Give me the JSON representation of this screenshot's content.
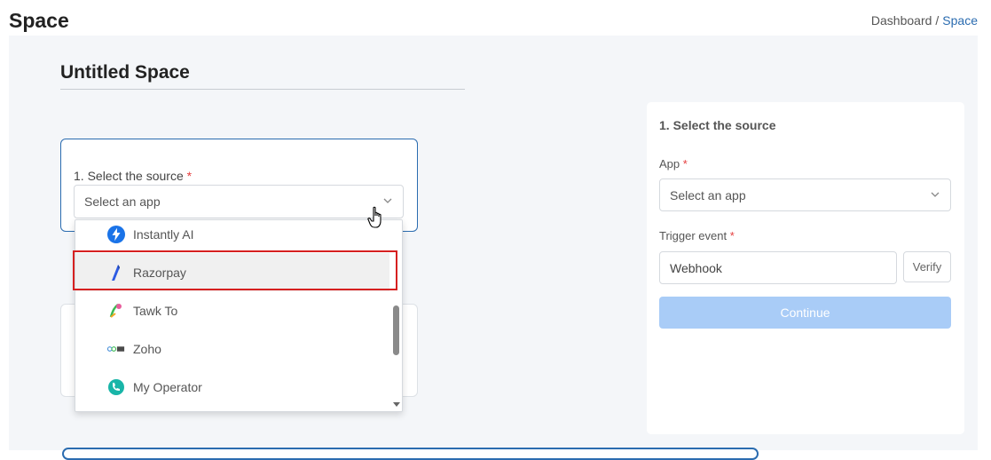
{
  "header": {
    "title": "Space",
    "breadcrumb": {
      "parent": "Dashboard",
      "separator": "/",
      "current": "Space"
    }
  },
  "space": {
    "title": "Untitled Space"
  },
  "source_card": {
    "step_label": "1.  Select the source",
    "required_mark": "*",
    "select": {
      "value": "Select an app",
      "icon": "chevron-down-icon"
    }
  },
  "dropdown": {
    "items": [
      {
        "label": "Instantly AI",
        "icon": "instantly-ai-icon",
        "color": "#1a73e8"
      },
      {
        "label": "Razorpay",
        "icon": "razorpay-icon",
        "color": "#2d5be3",
        "highlighted": true
      },
      {
        "label": "Tawk To",
        "icon": "tawk-to-icon",
        "color": "#3cba54"
      },
      {
        "label": "Zoho",
        "icon": "zoho-icon",
        "color": "#4a4a4a"
      },
      {
        "label": "My Operator",
        "icon": "my-operator-icon",
        "color": "#19b5a8"
      }
    ]
  },
  "side_panel": {
    "heading": "1. Select the source",
    "app_label": "App",
    "app_required": "*",
    "app_select": {
      "value": "Select an app"
    },
    "trigger_label": "Trigger event",
    "trigger_required": "*",
    "trigger_value": "Webhook",
    "verify_label": "Verify",
    "continue_label": "Continue"
  },
  "colors": {
    "accent": "#2b6cb0",
    "highlight_border": "#d62020",
    "continue_disabled": "#a9ccf7"
  }
}
